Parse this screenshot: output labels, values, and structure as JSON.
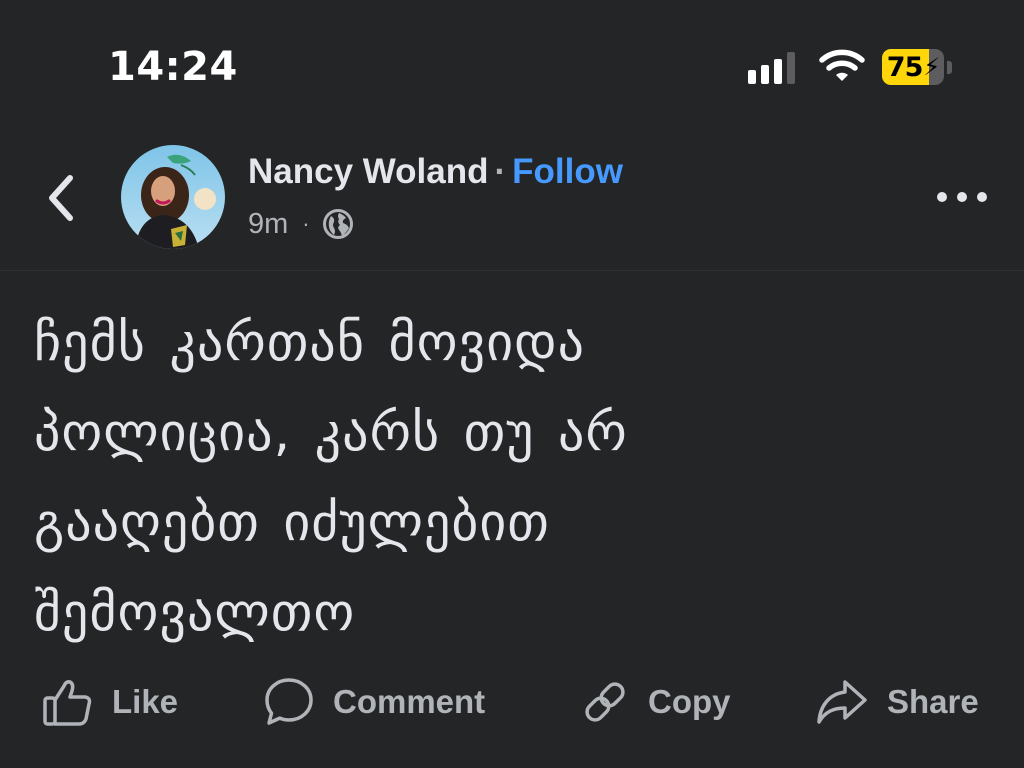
{
  "status_bar": {
    "time": "14:24",
    "battery_percent": "75",
    "battery_level": 0.75,
    "battery_charging": true,
    "icons": [
      "cellular-signal-icon",
      "wifi-icon",
      "battery-icon",
      "charging-bolt-icon"
    ]
  },
  "post": {
    "author": "Nancy Woland",
    "separator": "·",
    "follow_label": "Follow",
    "time_ago": "9m",
    "meta_separator": "·",
    "audience": "globe-icon",
    "text_lines": [
      "ჩემს კართან მოვიდა",
      "პოლიცია, კარს თუ არ",
      "გააღებთ იძულებით",
      "შემოვალთო"
    ]
  },
  "header": {
    "back_icon": "chevron-left-icon",
    "more_icon": "more-horizontal-icon"
  },
  "actions": {
    "like_label": "Like",
    "comment_label": "Comment",
    "copy_label": "Copy",
    "share_label": "Share"
  },
  "colors": {
    "background": "#242526",
    "primary_text": "#e4e6eb",
    "secondary_text": "#b0b3b8",
    "link": "#4599ff",
    "battery": "#ffd60a"
  }
}
